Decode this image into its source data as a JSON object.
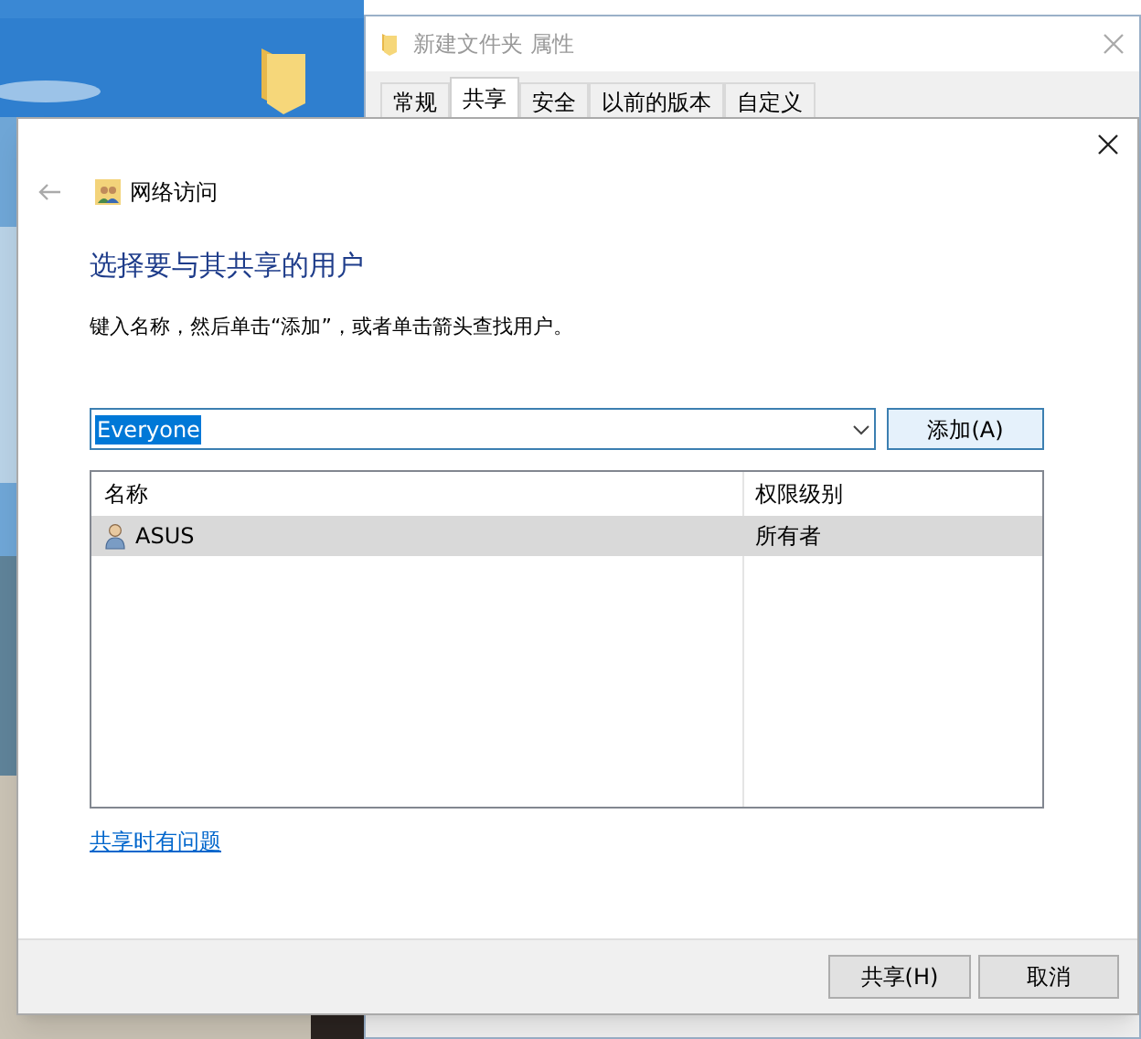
{
  "back_window": {
    "title": "新建文件夹 属性",
    "tabs": [
      {
        "label": "常规",
        "selected": false
      },
      {
        "label": "共享",
        "selected": true
      },
      {
        "label": "安全",
        "selected": false
      },
      {
        "label": "以前的版本",
        "selected": false
      },
      {
        "label": "自定义",
        "selected": false
      }
    ]
  },
  "dialog": {
    "title": "网络访问",
    "heading": "选择要与其共享的用户",
    "instruction": "键入名称，然后单击“添加”，或者单击箭头查找用户。",
    "combo": {
      "value": "Everyone"
    },
    "add_button": "添加(A)",
    "table": {
      "columns": [
        "名称",
        "权限级别"
      ],
      "rows": [
        {
          "name": "ASUS",
          "permission": "所有者",
          "selected": true
        }
      ]
    },
    "help_link": "共享时有问题",
    "buttons": [
      {
        "label": "共享(H)",
        "kind": "primary"
      },
      {
        "label": "取消",
        "kind": "normal"
      }
    ]
  }
}
